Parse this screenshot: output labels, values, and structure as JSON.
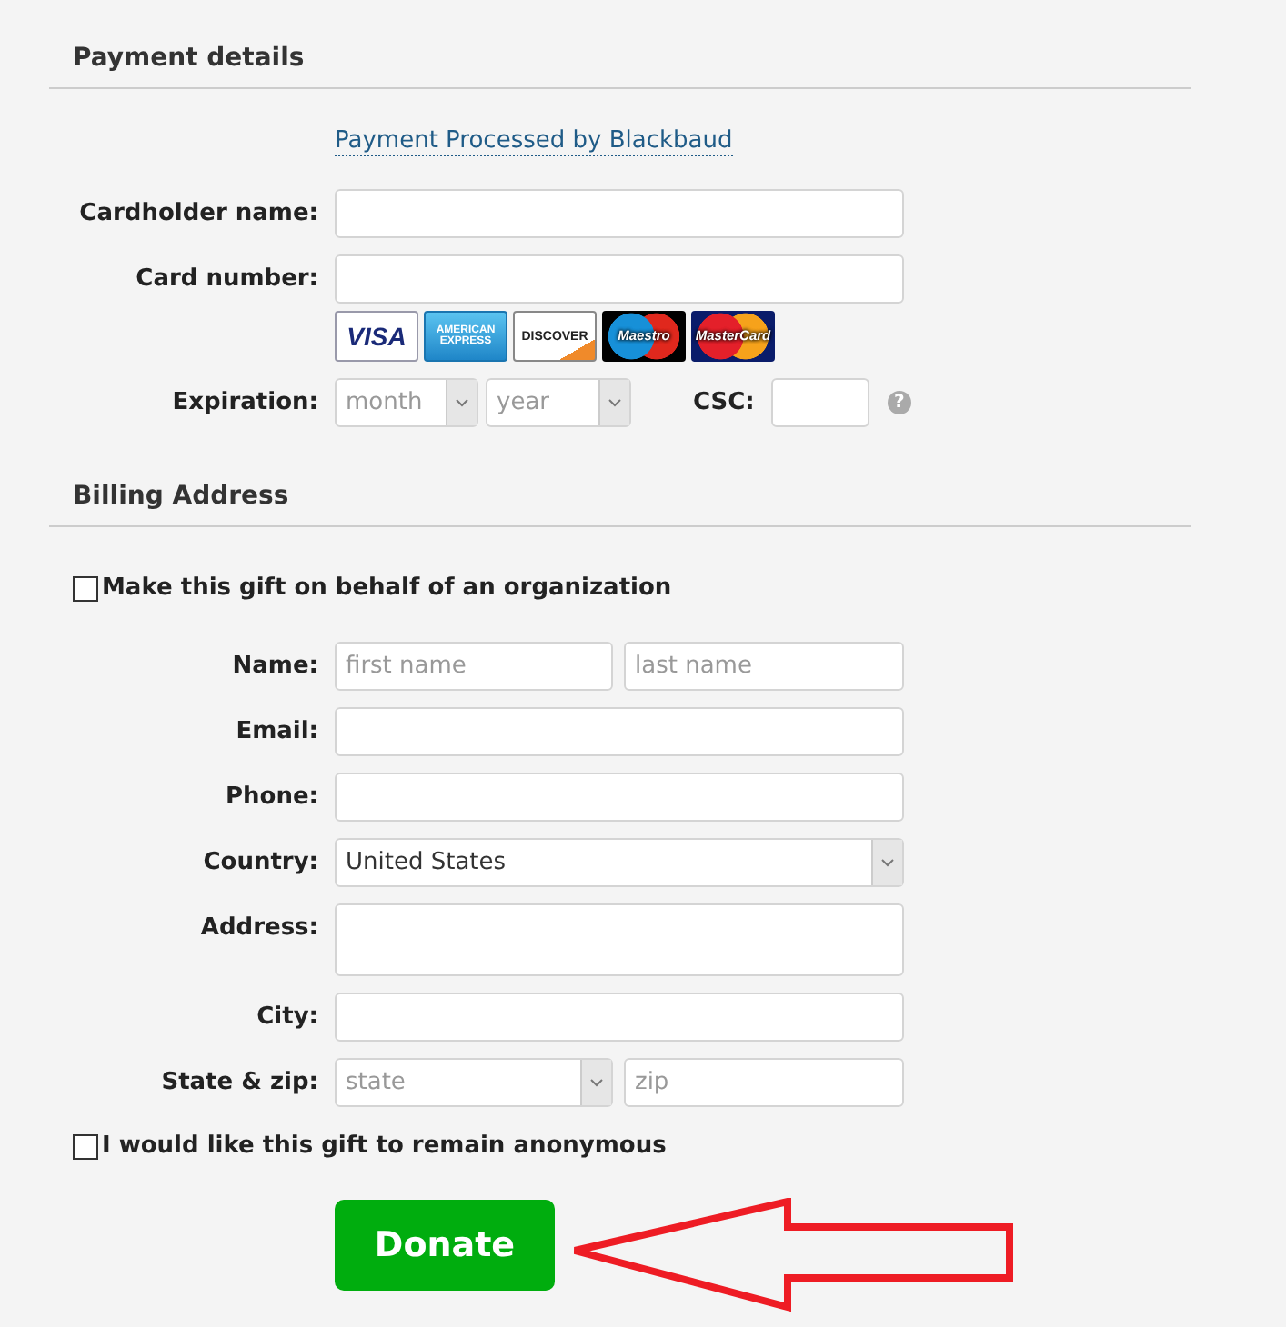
{
  "payment": {
    "heading": "Payment details",
    "processor_link": "Payment Processed by Blackbaud",
    "cardholder": {
      "label": "Cardholder name:"
    },
    "card_number": {
      "label": "Card number:"
    },
    "cards": [
      {
        "kind": "visa",
        "label": "VISA"
      },
      {
        "kind": "amex",
        "label": "AMERICAN EXPRESS"
      },
      {
        "kind": "discover",
        "label": "DISCOVER"
      },
      {
        "kind": "maestro",
        "label": "Maestro"
      },
      {
        "kind": "mastercard",
        "label": "MasterCard"
      }
    ],
    "expiration": {
      "label": "Expiration:",
      "month": "month",
      "year": "year"
    },
    "csc": {
      "label": "CSC:",
      "help": "?"
    }
  },
  "billing": {
    "heading": "Billing Address",
    "organization": {
      "label": "Make this gift on behalf of an organization",
      "checked": false
    },
    "rows": [
      {
        "kind": "name",
        "label": "Name:",
        "fields": [
          {
            "placeholder": "first name"
          },
          {
            "placeholder": "last name"
          }
        ]
      },
      {
        "kind": "text",
        "label": "Email:"
      },
      {
        "kind": "text",
        "label": "Phone:"
      },
      {
        "kind": "select",
        "label": "Country:",
        "value": "United States"
      },
      {
        "kind": "textarea",
        "label": "Address:"
      },
      {
        "kind": "text",
        "label": "City:"
      },
      {
        "kind": "statezip",
        "label": "State & zip:",
        "state": "state",
        "zip": {
          "placeholder": "zip"
        }
      }
    ],
    "anonymous": {
      "label": "I would like this gift to remain anonymous",
      "checked": false
    }
  },
  "donate_button": "Donate"
}
